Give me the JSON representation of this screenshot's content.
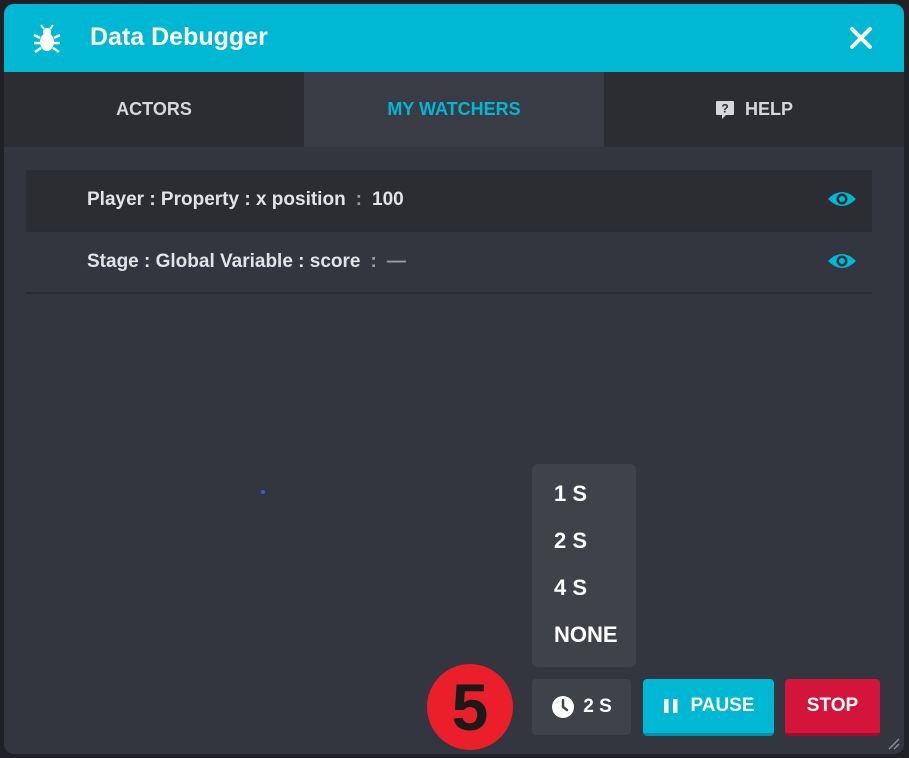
{
  "window": {
    "title": "Data Debugger"
  },
  "tabs": [
    {
      "label": "ACTORS",
      "active": false
    },
    {
      "label": "MY WATCHERS",
      "active": true
    },
    {
      "label": "HELP",
      "active": false
    }
  ],
  "watchers": [
    {
      "name": "Player : Property : x position",
      "separator": ":",
      "value": "100"
    },
    {
      "name": "Stage : Global Variable : score",
      "separator": ":",
      "value": "—"
    }
  ],
  "interval_menu": {
    "options": [
      "1 S",
      "2 S",
      "4 S",
      "NONE"
    ]
  },
  "step_badge": "5",
  "controls": {
    "interval_value": "2 S",
    "pause_label": "PAUSE",
    "stop_label": "STOP"
  },
  "colors": {
    "accent": "#00b8d4",
    "panel": "#33363e",
    "stop": "#d4153b",
    "badge": "#ea1f2a"
  },
  "icons": {
    "title": "bug-icon",
    "close": "close-icon",
    "help": "help-icon",
    "watch": "eye-icon",
    "interval": "clock-icon",
    "pause": "pause-icon"
  }
}
